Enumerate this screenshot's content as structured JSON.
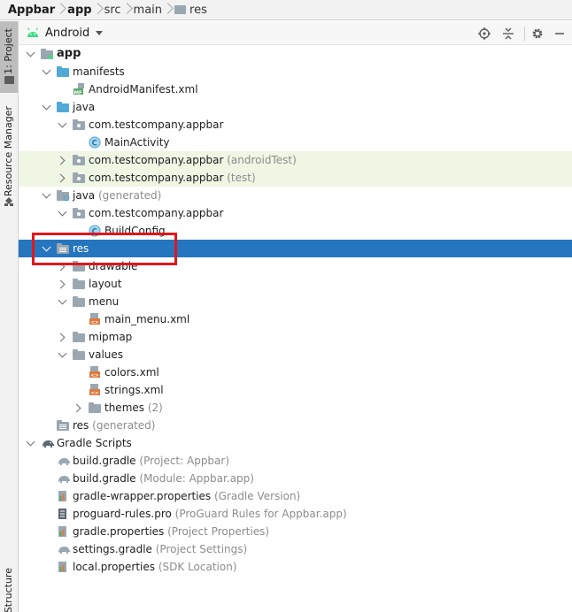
{
  "breadcrumb": {
    "items": [
      "Appbar",
      "app",
      "src",
      "main",
      "res"
    ]
  },
  "side_stripe": {
    "project_tab": "1: Project",
    "resource_manager_tab": "Resource Manager",
    "structure_tab": "Structure"
  },
  "toolbar": {
    "view_mode": "Android"
  },
  "tree": {
    "app": "app",
    "manifests": "manifests",
    "android_manifest": "AndroidManifest.xml",
    "java": "java",
    "pkg_main": "com.testcompany.appbar",
    "main_activity": "MainActivity",
    "pkg_android_test": "com.testcompany.appbar",
    "pkg_android_test_hint": "(androidTest)",
    "pkg_test": "com.testcompany.appbar",
    "pkg_test_hint": "(test)",
    "java_generated": "java",
    "java_generated_hint": "(generated)",
    "pkg_generated": "com.testcompany.appbar",
    "build_config": "BuildConfig",
    "res": "res",
    "drawable": "drawable",
    "layout": "layout",
    "menu": "menu",
    "main_menu": "main_menu.xml",
    "mipmap": "mipmap",
    "values": "values",
    "colors": "colors.xml",
    "strings": "strings.xml",
    "themes": "themes",
    "themes_count": "(2)",
    "res_generated": "res",
    "res_generated_hint": "(generated)",
    "gradle_scripts": "Gradle Scripts",
    "build_gradle_project": "build.gradle",
    "build_gradle_project_hint": "(Project: Appbar)",
    "build_gradle_module": "build.gradle",
    "build_gradle_module_hint": "(Module: Appbar.app)",
    "gradle_wrapper": "gradle-wrapper.properties",
    "gradle_wrapper_hint": "(Gradle Version)",
    "proguard": "proguard-rules.pro",
    "proguard_hint": "(ProGuard Rules for Appbar.app)",
    "gradle_properties": "gradle.properties",
    "gradle_properties_hint": "(Project Properties)",
    "settings_gradle": "settings.gradle",
    "settings_gradle_hint": "(Project Settings)",
    "local_properties": "local.properties",
    "local_properties_hint": "(SDK Location)"
  },
  "colors": {
    "selection": "#2675bf",
    "test_row_background": "#eff6e4",
    "highlight_box": "#e3161b"
  }
}
